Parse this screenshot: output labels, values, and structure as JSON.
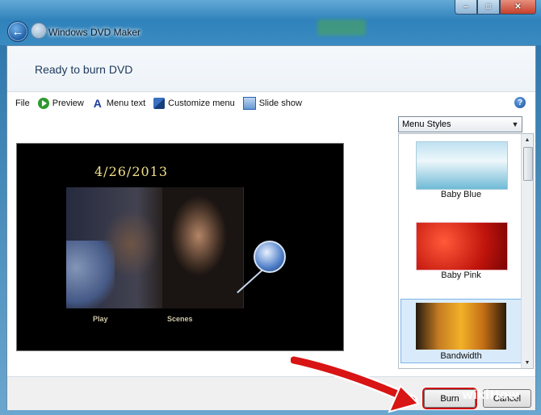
{
  "window": {
    "title": "Windows DVD Maker",
    "caption_buttons": [
      "minimize",
      "maximize",
      "close"
    ]
  },
  "header": {
    "title": "Ready to burn DVD"
  },
  "toolbar": {
    "file": "File",
    "preview": "Preview",
    "menu_text": "Menu text",
    "customize_menu": "Customize menu",
    "slide_show": "Slide show",
    "help": "?"
  },
  "preview": {
    "date_text": "4/26/2013",
    "play_label": "Play",
    "scenes_label": "Scenes"
  },
  "menu_styles": {
    "selected": "Menu Styles",
    "items": [
      {
        "label": "Baby Blue"
      },
      {
        "label": "Baby Pink"
      },
      {
        "label": "Bandwidth",
        "selected": true
      }
    ]
  },
  "footer": {
    "burn": "Burn",
    "cancel": "Cancel"
  },
  "watermark": "wikiHow",
  "colors": {
    "highlight_red": "#cc1111",
    "selection_blue": "#d9ebfa"
  }
}
